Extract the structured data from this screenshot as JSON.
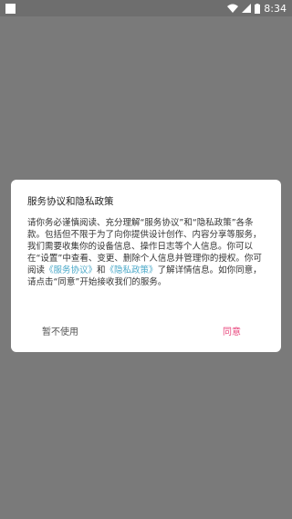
{
  "status_bar": {
    "time": "8:34",
    "icons": [
      "square-icon",
      "wifi-icon",
      "signal-icon",
      "battery-icon"
    ]
  },
  "dialog": {
    "title": "服务协议和隐私政策",
    "body_part1": "请你务必谨慎阅读、充分理解“服务协议”和“隐私政策”各条款。包括但不限于为了向你提供设计创作、内容分享等服务，我们需要收集你的设备信息、操作日志等个人信息。你可以在“设置”中查看、变更、删除个人信息并管理你的授权。你可阅读",
    "link_terms": "《服务协议》",
    "conjunction": "和",
    "link_privacy": "《隐私政策》",
    "body_part2": "了解详情信息。如你同意，请点击“同意”开始接收我们的服务。",
    "decline_label": "暂不使用",
    "agree_label": "同意"
  },
  "colors": {
    "overlay": "#7a7a7a",
    "accent_agree": "#e8467c",
    "link": "#4aa8c8"
  }
}
